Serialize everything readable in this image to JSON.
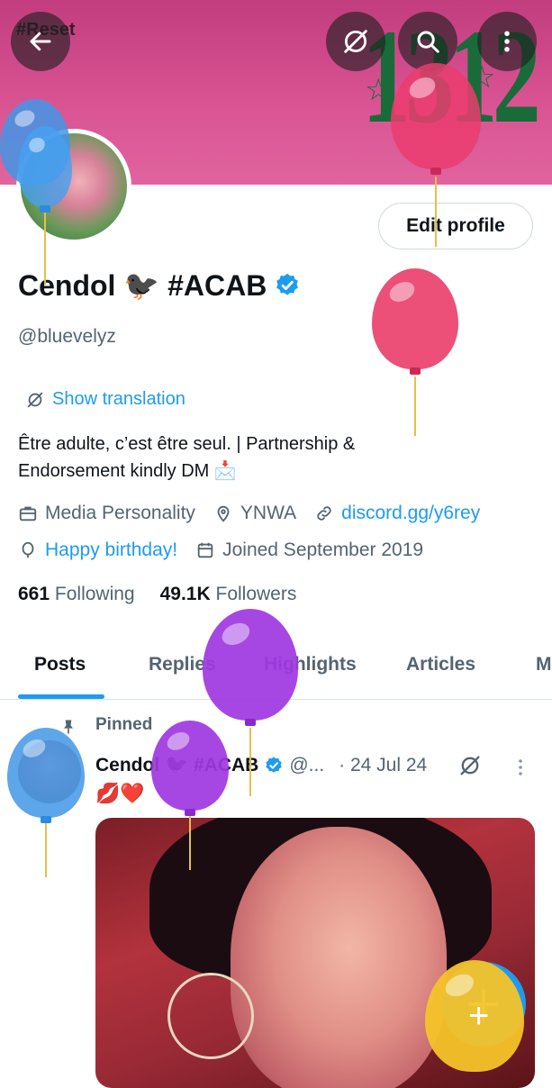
{
  "banner": {
    "big_text": "1312",
    "hash_text": "#Reset"
  },
  "header_buttons": {
    "back_icon": "arrow-left-icon",
    "translate_icon": "translate-icon",
    "search_icon": "search-icon",
    "more_icon": "more-vertical-icon"
  },
  "profile": {
    "display_name": "Cendol 🐦‍⬛ #ACAB",
    "handle": "@bluevelyz",
    "edit_label": "Edit profile",
    "show_translation": "Show translation",
    "bio_line1": "Être adulte, c’est être seul. | Partnership &",
    "bio_line2": "Endorsement kindly DM 📩",
    "category": "Media Personality",
    "location": "YNWA",
    "website": "discord.gg/y6rey",
    "birthday": "Happy birthday!",
    "joined": "Joined September 2019",
    "following_count": "661",
    "following_label": "Following",
    "followers_count": "49.1K",
    "followers_label": "Followers"
  },
  "tabs": [
    {
      "label": "Posts"
    },
    {
      "label": "Replies"
    },
    {
      "label": "Highlights"
    },
    {
      "label": "Articles"
    },
    {
      "label": "M"
    }
  ],
  "post": {
    "pinned_label": "Pinned",
    "author": "Cendol 🐦‍⬛ #ACAB",
    "handle": "@...",
    "date": "· 24 Jul 24",
    "text": "💋❤️"
  },
  "fab": {
    "icon": "plus-icon"
  },
  "colors": {
    "accent": "#1d9bf0",
    "banner": "#d4508f",
    "banner_text": "#1a6b3a"
  }
}
